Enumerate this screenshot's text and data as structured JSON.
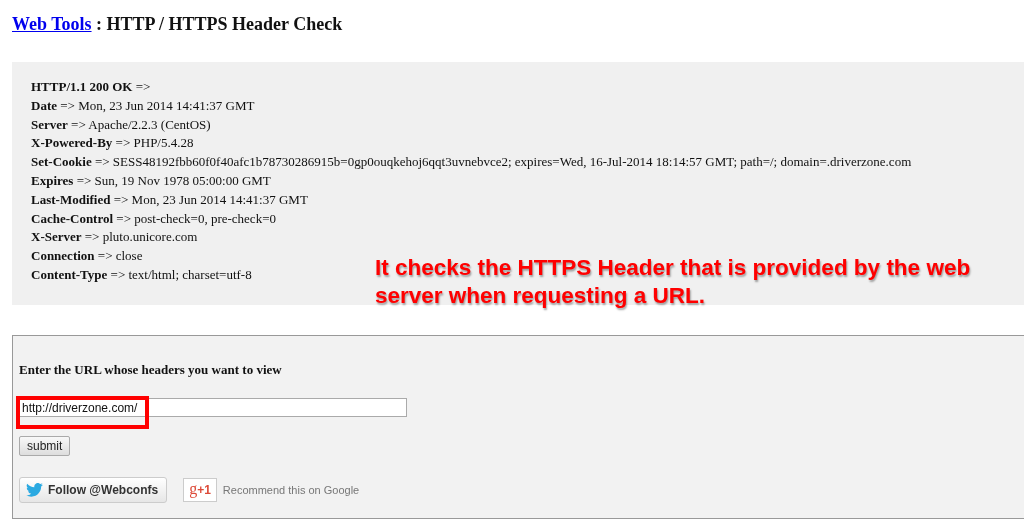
{
  "title": {
    "link": "Web Tools",
    "rest": " : HTTP / HTTPS Header Check"
  },
  "headers": [
    "**HTTP/1.1 200 OK** =>",
    "**Date** => Mon, 23 Jun 2014 14:41:37 GMT",
    "**Server** => Apache/2.2.3 (CentOS)",
    "**X-Powered-By** => PHP/5.4.28",
    "**Set-Cookie** => SESS48192fbb60f0f40afc1b78730286915b=0gp0ouqkehoj6qqt3uvnebvce2; expires=Wed, 16-Jul-2014 18:14:57 GMT; path=/; domain=.driverzone.com",
    "**Expires** => Sun, 19 Nov 1978 05:00:00 GMT",
    "**Last-Modified** => Mon, 23 Jun 2014 14:41:37 GMT",
    "**Cache-Control** => post-check=0, pre-check=0",
    "**X-Server** => pluto.unicore.com",
    "**Connection** => close",
    "**Content-Type** => text/html; charset=utf-8"
  ],
  "annotation": "It checks the HTTPS Header that is provided by the web server when requesting a URL.",
  "form": {
    "label": "Enter the URL whose headers you want to view",
    "url_value": "http://driverzone.com/",
    "submit": "submit"
  },
  "social": {
    "twitter": "Follow @Webconfs",
    "gplus": "+1",
    "gplus_g": "g",
    "gplus_text": "Recommend this on Google"
  }
}
